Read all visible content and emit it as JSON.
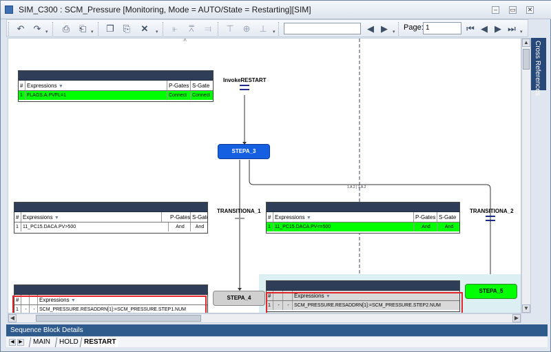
{
  "window": {
    "title": "SIM_C300 : SCM_Pressure [Monitoring, Mode  = AUTO/State = Restarting][SIM]",
    "minimize_glyph": "–",
    "restore_glyph": "▭",
    "close_glyph": "✕"
  },
  "toolbar": {
    "page_label": "Page:",
    "page_value": "1",
    "search_value": ""
  },
  "side_panel": {
    "label": "Cross References"
  },
  "diagram": {
    "divider_caret": "˄",
    "table1": {
      "cols": [
        "#",
        "Expressions",
        "P-Gates",
        "S-Gate"
      ],
      "row": {
        "num": "1",
        "expr": "FLAGS.A.PVFL=1",
        "pgate": "Connect",
        "sgate": "Connect"
      }
    },
    "invoke_label": "InvokeRESTART",
    "stepa3": "STEPA_3",
    "branch_label": "1.A.2  |  1.A.2",
    "transition1_label": "TRANSITIONA_1",
    "transition2_label": "TRANSITIONA_2",
    "table2": {
      "cols": [
        "#",
        "Expressions",
        "P-Gates",
        "S-Gate"
      ],
      "row": {
        "num": "1",
        "expr": "11_PC15.DACA.PV>500",
        "pgate": "And",
        "sgate": "And"
      }
    },
    "table3": {
      "cols": [
        "#",
        "Expressions",
        "P-Gates",
        "S-Gate"
      ],
      "row": {
        "num": "1",
        "expr": "11_PC15.DACA.PV<=500",
        "pgate": "And",
        "sgate": "And"
      }
    },
    "table4": {
      "cols": [
        "#",
        "Expressions"
      ],
      "row": {
        "num": "1",
        "d1": "-",
        "d2": "-",
        "expr": "SCM_PRESSURE.RESADDRN[1]:=SCM_PRESSURE.STEP1.NUM"
      }
    },
    "table5": {
      "cols": [
        "#",
        "Expressions"
      ],
      "row": {
        "num": "1",
        "d1": "-",
        "d2": "-",
        "expr": "SCM_PRESSURE.RESADDRN[1]:=SCM_PRESSURE.STEP2.NUM"
      }
    },
    "stepa4": "STEPA_4",
    "stepa5": "STEPA_5"
  },
  "panel": {
    "title": "Sequence Block Details"
  },
  "tabs": [
    "MAIN",
    "HOLD",
    "RESTART"
  ],
  "colors": {
    "active_step_blue": "#1560e0",
    "active_transition_green": "#00ff00",
    "highlight_red": "#e0262b",
    "header_navy": "#2f3d58"
  }
}
